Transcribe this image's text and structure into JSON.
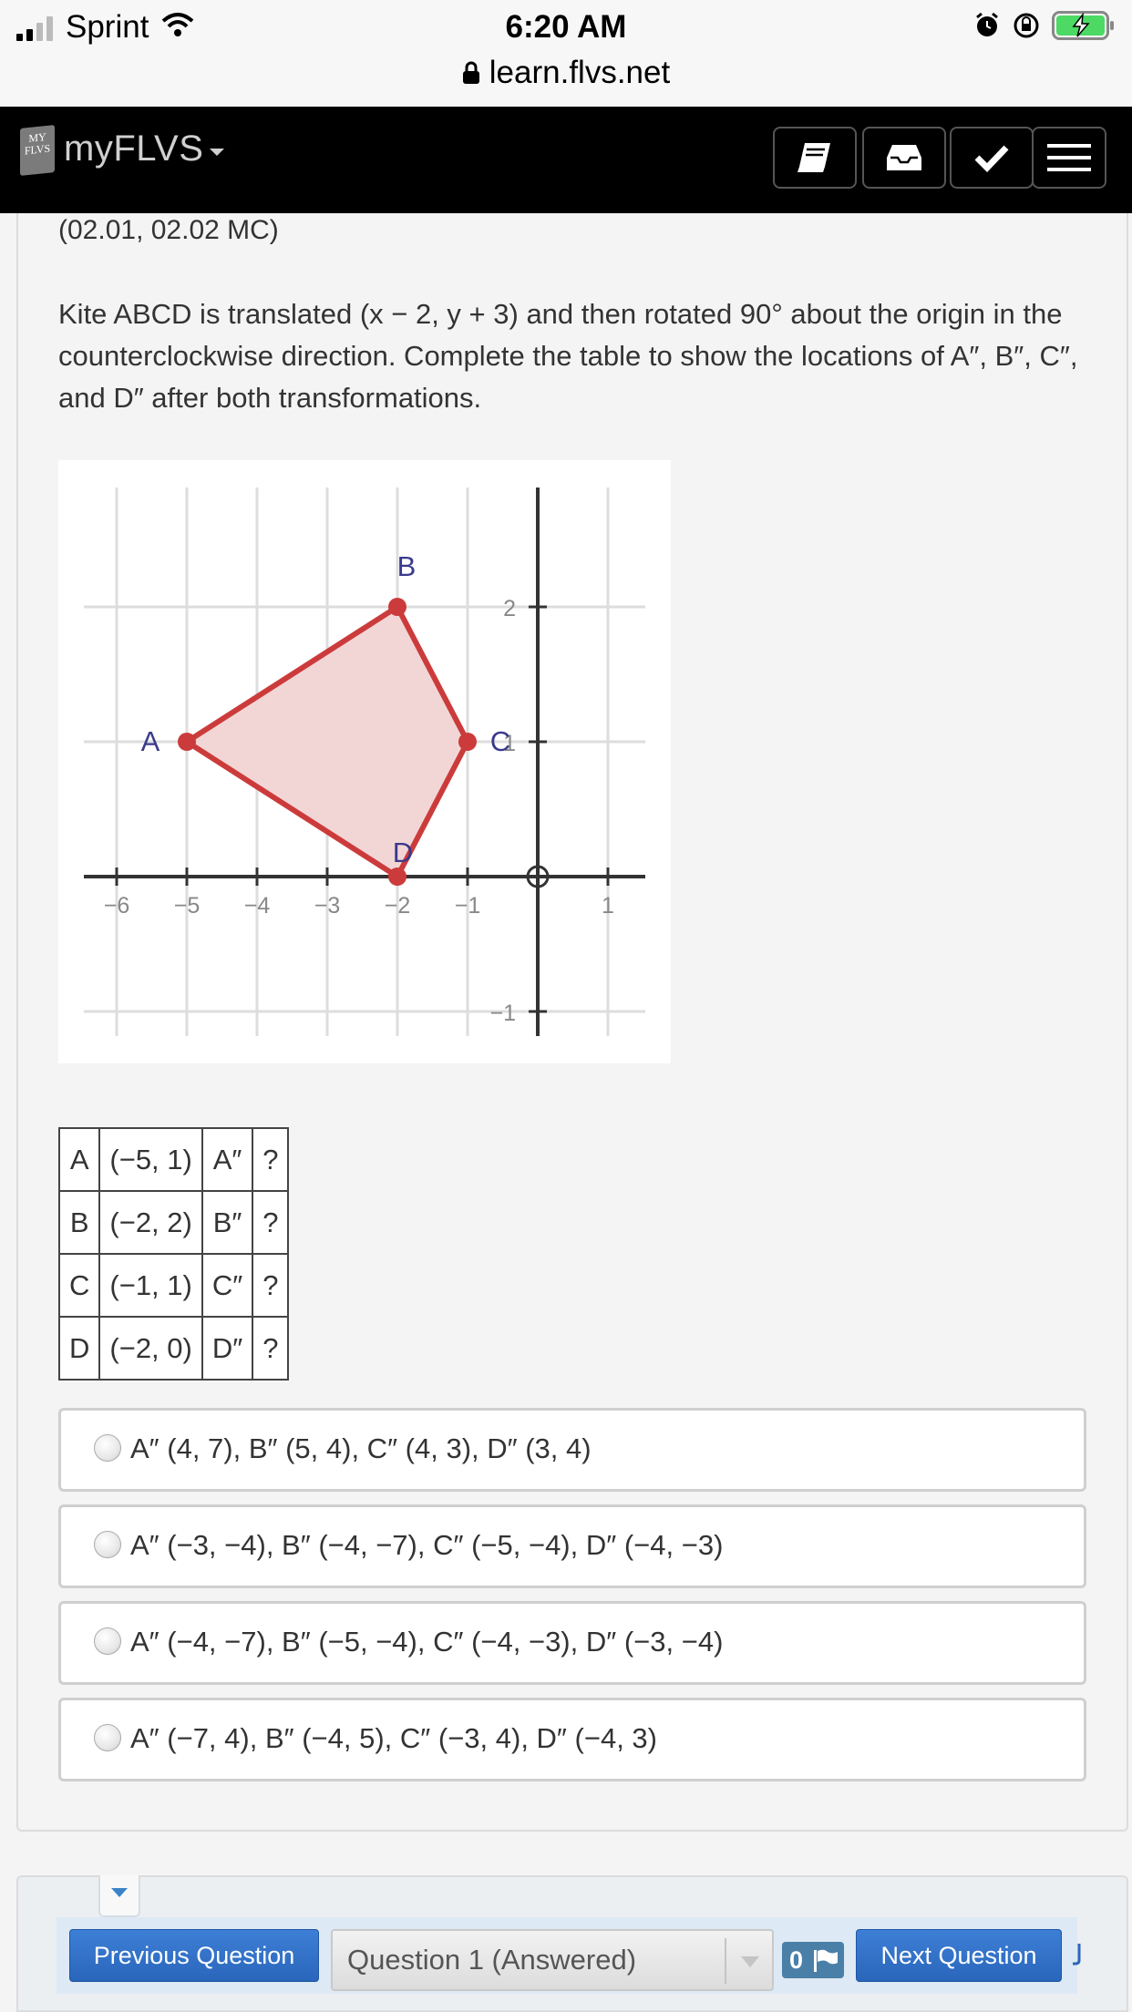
{
  "status_bar": {
    "carrier": "Sprint",
    "time": "6:20 AM",
    "url": "learn.flvs.net",
    "icons": [
      "signal-icon",
      "wifi-icon",
      "alarm-icon",
      "rotation-lock-icon",
      "battery-charging-icon"
    ]
  },
  "app_header": {
    "logo_text": "MY FLVS",
    "brand": "myFLVS",
    "buttons": [
      "book-icon",
      "inbox-icon",
      "checkmark-icon",
      "hamburger-menu-icon"
    ],
    "colors": {
      "background": "#000000",
      "brand_text": "#cfcfcf"
    }
  },
  "question": {
    "code": "(02.01, 02.02 MC)",
    "prompt": "Kite ABCD is translated (x − 2, y + 3) and then rotated 90° about the origin in the counterclockwise direction. Complete the table to show the locations of A″, B″, C″, and D″ after both transformations."
  },
  "graph": {
    "x_ticks": [
      "−6",
      "−5",
      "−4",
      "−3",
      "−2",
      "−1",
      "1"
    ],
    "y_ticks": [
      "2",
      "1",
      "−1"
    ],
    "x_range": [
      -6.5,
      1.5
    ],
    "y_range": [
      -1.2,
      2.8
    ],
    "points": [
      {
        "label": "A",
        "x": -5,
        "y": 1
      },
      {
        "label": "B",
        "x": -2,
        "y": 2
      },
      {
        "label": "C",
        "x": -1,
        "y": 1
      },
      {
        "label": "D",
        "x": -2,
        "y": 0
      }
    ],
    "colors": {
      "stroke": "#cc3b3b",
      "fill": "#f2d6d6",
      "label": "#3a3a8c",
      "grid": "#dddddd",
      "axis": "#333333"
    }
  },
  "table": {
    "rows": [
      [
        "A",
        "(−5, 1)",
        "A″",
        "?"
      ],
      [
        "B",
        "(−2, 2)",
        "B″",
        "?"
      ],
      [
        "C",
        "(−1, 1)",
        "C″",
        "?"
      ],
      [
        "D",
        "(−2, 0)",
        "D″",
        "?"
      ]
    ]
  },
  "choices": [
    "A″ (4, 7), B″ (5, 4), C″ (4, 3), D″ (3, 4)",
    "A″ (−3, −4), B″ (−4, −7), C″ (−5, −4), D″ (−4, −3)",
    "A″ (−4, −7), B″ (−5, −4), C″ (−4, −3), D″ (−3, −4)",
    "A″ (−7, 4), B″ (−4, 5), C″ (−3, 4), D″ (−4, 3)"
  ],
  "nav": {
    "previous_label": "Previous Question",
    "question_select": "Question 1 (Answered)",
    "flag_count": "0",
    "next_label": "Next Question",
    "colors": {
      "button": "#2f6fc6",
      "badge": "#4a7fa8"
    }
  }
}
